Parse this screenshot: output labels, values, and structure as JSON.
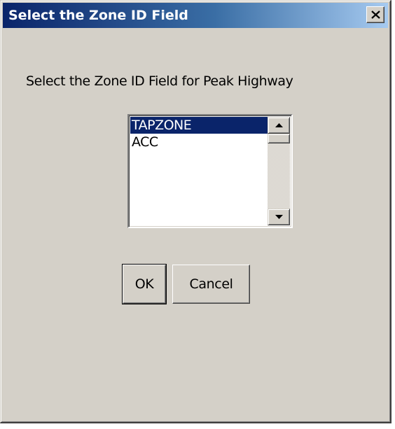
{
  "window": {
    "title": "Select the Zone ID Field",
    "close_label": "Close"
  },
  "dialog": {
    "prompt": "Select the Zone ID Field for Peak Highway",
    "fields": [
      {
        "label": "TAPZONE",
        "selected": true
      },
      {
        "label": "ACC",
        "selected": false
      }
    ],
    "ok_label": "OK",
    "cancel_label": "Cancel"
  },
  "colors": {
    "dialog_bg": "#d4d0c8",
    "selection_bg": "#0a246a",
    "title_start": "#0a246a",
    "title_end": "#a6caf0"
  },
  "icons": {
    "close": "close-x-icon",
    "scroll_up": "arrow-up-icon",
    "scroll_down": "arrow-down-icon"
  }
}
